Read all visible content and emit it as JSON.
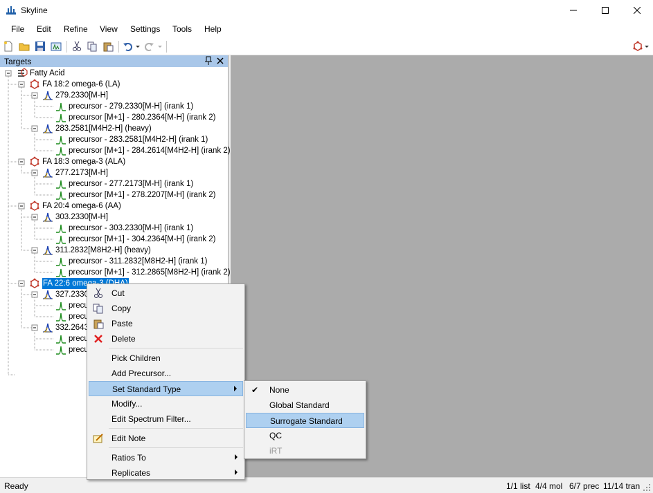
{
  "window": {
    "title": "Skyline"
  },
  "menu": [
    "File",
    "Edit",
    "Refine",
    "View",
    "Settings",
    "Tools",
    "Help"
  ],
  "panel": {
    "title": "Targets"
  },
  "tree": {
    "root": "Fatty Acid",
    "groups": [
      {
        "label": "FA 18:2 omega-6 (LA)",
        "precursors": [
          {
            "label": "279.2330[M-H]",
            "transitions": [
              "precursor - 279.2330[M-H] (irank 1)",
              "precursor [M+1] - 280.2364[M-H] (irank 2)"
            ]
          },
          {
            "label": "283.2581[M4H2-H] (heavy)",
            "transitions": [
              "precursor - 283.2581[M4H2-H] (irank 1)",
              "precursor [M+1] - 284.2614[M4H2-H] (irank 2)"
            ]
          }
        ]
      },
      {
        "label": "FA 18:3 omega-3 (ALA)",
        "precursors": [
          {
            "label": "277.2173[M-H]",
            "transitions": [
              "precursor - 277.2173[M-H] (irank 1)",
              "precursor [M+1] - 278.2207[M-H] (irank 2)"
            ]
          }
        ]
      },
      {
        "label": "FA 20:4 omega-6 (AA)",
        "precursors": [
          {
            "label": "303.2330[M-H]",
            "transitions": [
              "precursor - 303.2330[M-H] (irank 1)",
              "precursor [M+1] - 304.2364[M-H] (irank 2)"
            ]
          },
          {
            "label": "311.2832[M8H2-H] (heavy)",
            "transitions": [
              "precursor - 311.2832[M8H2-H] (irank 1)",
              "precursor [M+1] - 312.2865[M8H2-H] (irank 2)"
            ]
          }
        ]
      },
      {
        "label": "FA 22:6 omega-3 (DHA)",
        "precursors": [
          {
            "label": "327.2330",
            "transitions": [
              "precu",
              "precu"
            ]
          },
          {
            "label": "332.2643",
            "transitions": [
              "precu",
              "precu"
            ]
          }
        ]
      }
    ]
  },
  "context_menu": {
    "items": [
      {
        "label": "Cut",
        "icon": "scissors-icon"
      },
      {
        "label": "Copy",
        "icon": "copy-icon"
      },
      {
        "label": "Paste",
        "icon": "paste-icon"
      },
      {
        "label": "Delete",
        "icon": "delete-x-icon"
      },
      {
        "label": "Pick Children"
      },
      {
        "label": "Add Precursor..."
      },
      {
        "label": "Set Standard Type",
        "submenu": true,
        "highlighted": true
      },
      {
        "label": "Modify..."
      },
      {
        "label": "Edit Spectrum Filter..."
      },
      {
        "label": "Edit Note",
        "icon": "note-icon"
      },
      {
        "label": "Ratios To",
        "submenu": true
      },
      {
        "label": "Replicates",
        "submenu": true
      }
    ]
  },
  "submenu": {
    "items": [
      {
        "label": "None",
        "checked": true
      },
      {
        "label": "Global Standard"
      },
      {
        "label": "Surrogate Standard",
        "highlighted": true
      },
      {
        "label": "QC"
      },
      {
        "label": "iRT",
        "disabled": true
      }
    ]
  },
  "status": {
    "ready": "Ready",
    "list": "1/1 list",
    "mol": "4/4 mol",
    "prec": "6/7 prec",
    "tran": "11/14 tran"
  },
  "colors": {
    "selection": "#0078d7",
    "menu_highlight": "#aed0f0",
    "panel_header": "#a9c7e9",
    "workspace": "#ababab"
  }
}
